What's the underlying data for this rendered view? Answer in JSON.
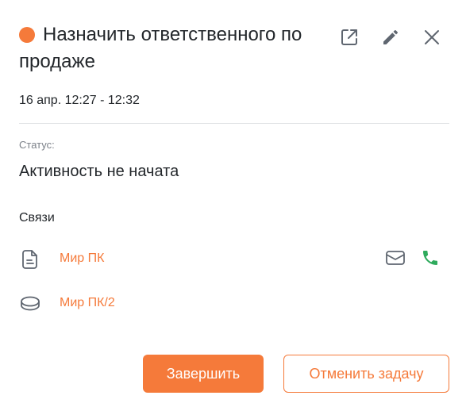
{
  "task": {
    "title_line1": "Назначить ответственного по",
    "title_line2": "продаже",
    "time_range": "16 апр. 12:27 - 12:32",
    "status_label": "Статус:",
    "status_value": "Активность не начата",
    "status_dot_color": "#f57a3a"
  },
  "header_actions": {
    "open_icon": "external-link-icon",
    "edit_icon": "pencil-icon",
    "close_icon": "close-icon"
  },
  "links": {
    "heading": "Связи",
    "items": [
      {
        "label": "Мир ПК",
        "icon": "document-icon",
        "actions": [
          "mail-icon",
          "phone-icon"
        ]
      },
      {
        "label": "Мир ПК/2",
        "icon": "coins-icon",
        "actions": []
      }
    ]
  },
  "buttons": {
    "complete": "Завершить",
    "cancel": "Отменить задачу"
  },
  "colors": {
    "accent": "#f57a3a",
    "phone": "#2eaa5c",
    "icon_gray": "#5f6670"
  }
}
